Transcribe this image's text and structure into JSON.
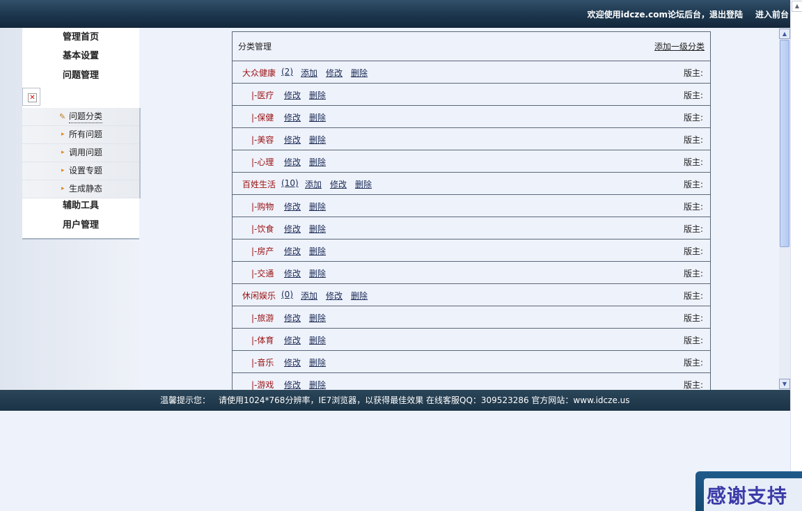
{
  "header": {
    "welcome_text": "欢迎使用idcze.com论坛后台，",
    "logout_label": "退出登陆",
    "frontend_label": "进入前台"
  },
  "sidebar": {
    "heads": [
      "管理首页",
      "基本设置",
      "问题管理",
      "辅助工具",
      "用户管理"
    ],
    "sub_items": [
      {
        "label": "问题分类",
        "active": true
      },
      {
        "label": "所有问题",
        "active": false
      },
      {
        "label": "调用问题",
        "active": false
      },
      {
        "label": "设置专题",
        "active": false
      },
      {
        "label": "生成静态",
        "active": false
      }
    ]
  },
  "panel": {
    "title": "分类管理",
    "add_top_label": "添加一级分类",
    "moderator_label": "版主:",
    "actions": {
      "add": "添加",
      "edit": "修改",
      "delete": "删除"
    },
    "rows": [
      {
        "name": "大众健康",
        "count": "(2)",
        "level": 1
      },
      {
        "name": "|-医疗",
        "level": 2
      },
      {
        "name": "|-保健",
        "level": 2
      },
      {
        "name": "|-美容",
        "level": 2
      },
      {
        "name": "|-心理",
        "level": 2
      },
      {
        "name": "百姓生活",
        "count": "(10)",
        "level": 1
      },
      {
        "name": "|-购物",
        "level": 2
      },
      {
        "name": "|-饮食",
        "level": 2
      },
      {
        "name": "|-房产",
        "level": 2
      },
      {
        "name": "|-交通",
        "level": 2
      },
      {
        "name": "休闲娱乐",
        "count": "(0)",
        "level": 1
      },
      {
        "name": "|-旅游",
        "level": 2
      },
      {
        "name": "|-体育",
        "level": 2
      },
      {
        "name": "|-音乐",
        "level": 2
      },
      {
        "name": "|-游戏",
        "level": 2
      }
    ]
  },
  "footer": {
    "tip_label": "温馨提示您：",
    "info_text": "请使用1024*768分辨率，IE7浏览器，以获得最佳效果 在线客服QQ：309523286   官方网站：www.idcze.us"
  },
  "badge": {
    "text": "感谢支持"
  }
}
